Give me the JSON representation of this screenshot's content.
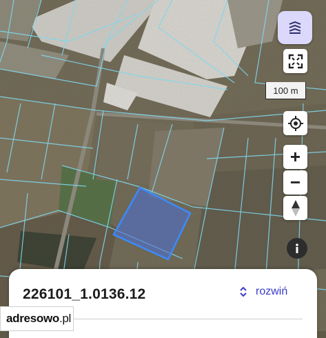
{
  "map": {
    "colors": {
      "parcel_border": "#7fd8ee",
      "selected_fill": "#4a6fd8",
      "selected_border": "#3a8bff"
    }
  },
  "controls": {
    "layers_icon": "layers-icon",
    "fullscreen_icon": "fullscreen-icon",
    "scale_label": "100 m",
    "locate_icon": "locate-icon",
    "zoom_in_label": "+",
    "zoom_out_label": "−",
    "compass_icon": "compass-icon",
    "info_icon": "info-icon"
  },
  "panel": {
    "parcel_id": "226101_1.0136.12",
    "expand_label": "rozwiń",
    "expand_icon": "chevron-updown-icon"
  },
  "brand": {
    "name": "adresowo",
    "suffix": ".pl"
  }
}
